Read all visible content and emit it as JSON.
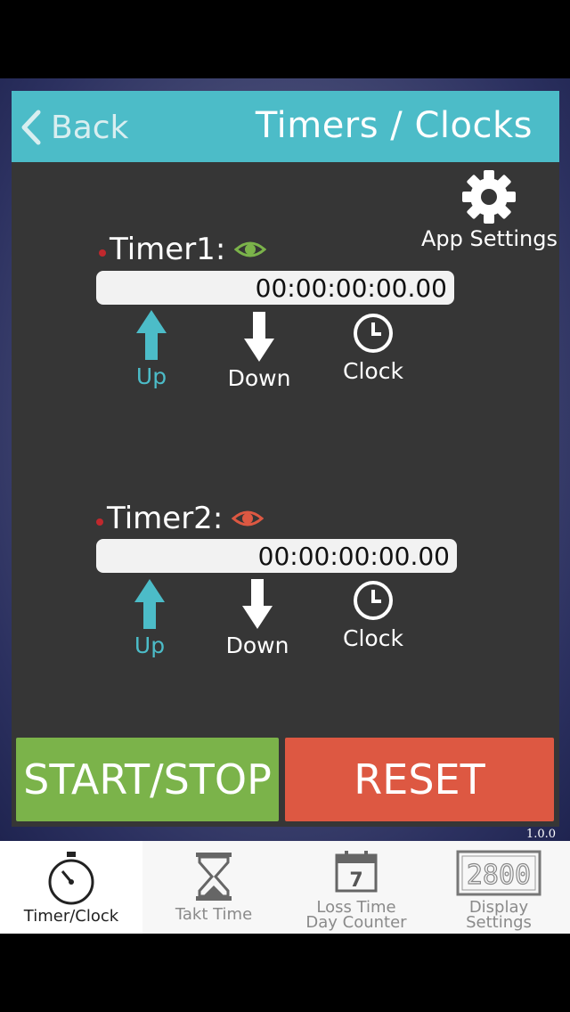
{
  "header": {
    "back_label": "Back",
    "title": "Timers / Clocks"
  },
  "settings": {
    "label": "App Settings"
  },
  "timers": [
    {
      "label": "Timer1:",
      "value": "00:00:00:00.00",
      "visible_color": "#7bb34a",
      "mode": "Up"
    },
    {
      "label": "Timer2:",
      "value": "00:00:00:00.00",
      "visible_color": "#dd5842",
      "mode": "Up"
    }
  ],
  "modes": {
    "up": "Up",
    "down": "Down",
    "clock": "Clock"
  },
  "actions": {
    "start_stop": "START/STOP",
    "reset": "RESET"
  },
  "version": "1.0.0",
  "tabs": [
    {
      "label": "Timer/Clock",
      "icon": "stopwatch-icon",
      "active": true
    },
    {
      "label": "Takt Time",
      "icon": "hourglass-icon",
      "active": false
    },
    {
      "label": "Loss Time\nDay Counter",
      "line1": "Loss Time",
      "line2": "Day Counter",
      "icon": "calendar-icon",
      "calendar_number": "7",
      "active": false
    },
    {
      "label": "Display\nSettings",
      "line1": "Display",
      "line2": "Settings",
      "icon": "seven-segment-display-icon",
      "display_text": "2800",
      "active": false
    }
  ],
  "colors": {
    "accent": "#4cbcc8",
    "start": "#7bb34a",
    "reset": "#dd5842",
    "panel": "#363636"
  }
}
